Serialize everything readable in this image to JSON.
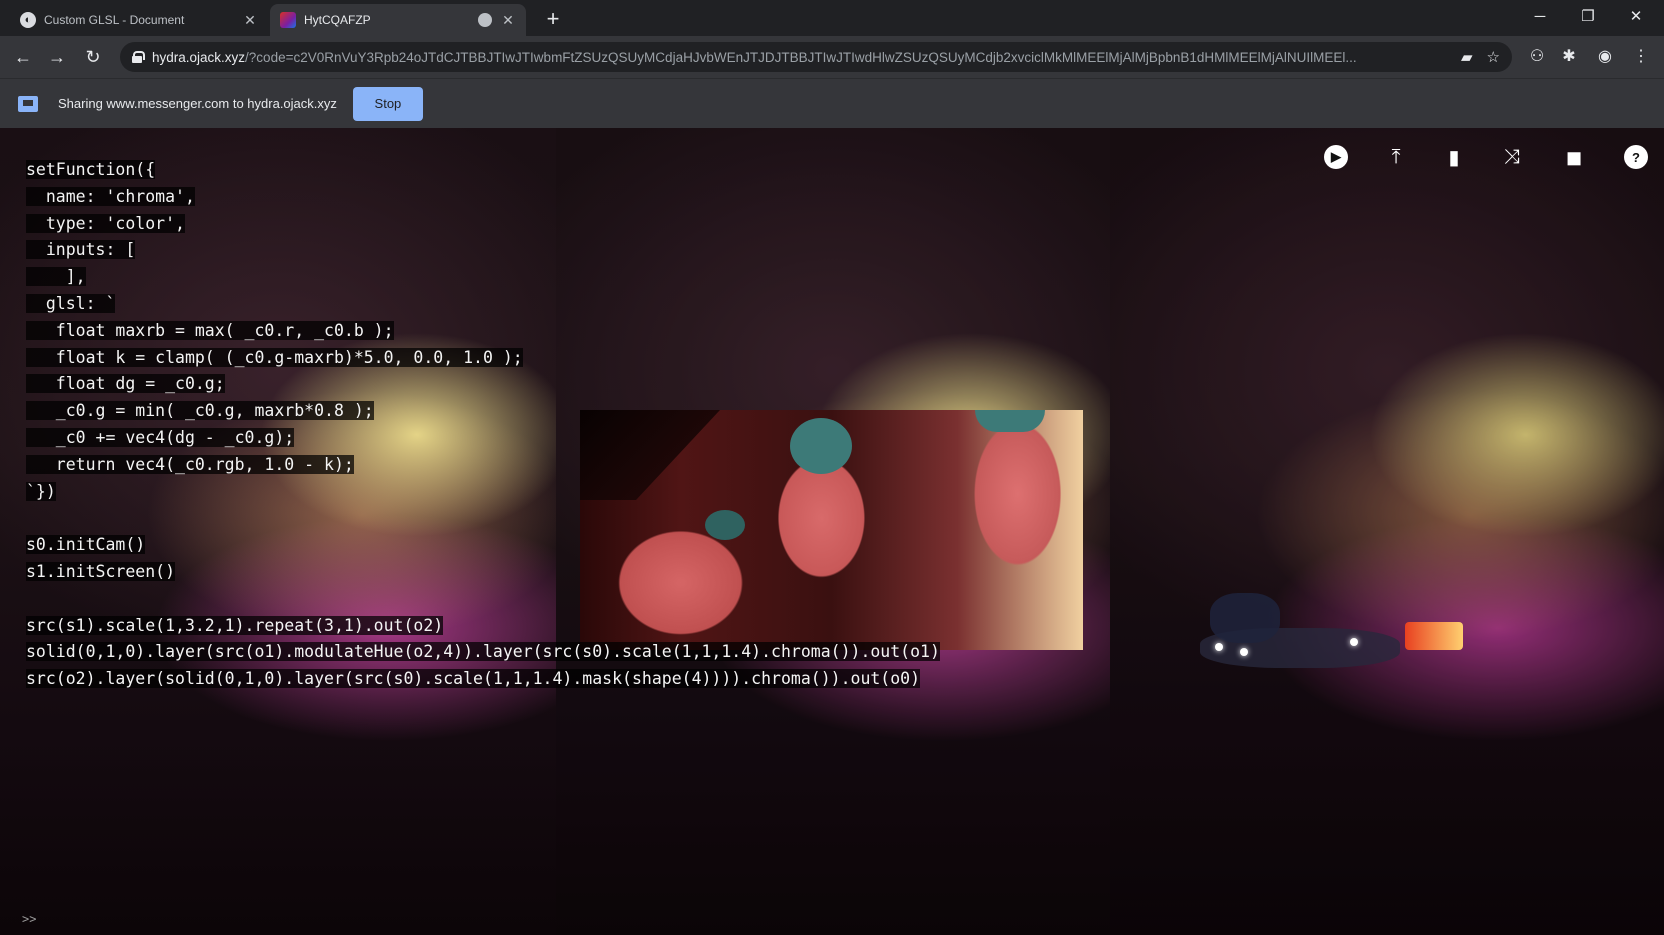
{
  "browser": {
    "tabs": [
      {
        "title": "Custom GLSL - Document",
        "active": false
      },
      {
        "title": "HytCQAFZP",
        "active": true
      }
    ],
    "new_tab_label": "+",
    "window_controls": {
      "minimize": "─",
      "restore": "❐",
      "close": "✕"
    },
    "url_host": "hydra.ojack.xyz",
    "url_rest": "/?code=c2V0RnVuY3Rpb24oJTdCJTBBJTIwJTIwbmFtZSUzQSUyMCdjaHJvbWEnJTJDJTBBJTIwJTIwdHlwZSUzQSUyMCdjb2xvciclMkMlMEElMjAlMjBpbnB1dHMlMEElMjAlNUIlMEEl...",
    "omnibox_icons": [
      "cast-icon",
      "star-icon"
    ],
    "toolbar_icons": [
      "extension-badge-icon",
      "puzzle-icon",
      "profile-icon",
      "menu-icon"
    ]
  },
  "share_bar": {
    "text": "Sharing www.messenger.com to hydra.ojack.xyz",
    "stop_label": "Stop"
  },
  "editor": {
    "lines": [
      "setFunction({",
      "  name: 'chroma',",
      "  type: 'color',",
      "  inputs: [",
      "    ],",
      "  glsl: `",
      "   float maxrb = max( _c0.r, _c0.b );",
      "   float k = clamp( (_c0.g-maxrb)*5.0, 0.0, 1.0 );",
      "   float dg = _c0.g;",
      "   _c0.g = min( _c0.g, maxrb*0.8 );",
      "   _c0 += vec4(dg - _c0.g);",
      "   return vec4(_c0.rgb, 1.0 - k);",
      "`})",
      "",
      "s0.initCam()",
      "s1.initScreen()",
      "",
      "src(s1).scale(1,3.2,1).repeat(3,1).out(o2)",
      "solid(0,1,0).layer(src(o1).modulateHue(o2,4)).layer(src(s0).scale(1,1,1.4).chroma()).out(o1)",
      "src(o2).layer(solid(0,1,0).layer(src(s0).scale(1,1,1.4).mask(shape(4)))).chroma()).out(o0)"
    ],
    "prompt": ">>"
  },
  "hydra_toolbar": [
    {
      "name": "run-icon",
      "glyph": "▶"
    },
    {
      "name": "upload-icon",
      "glyph": "⤒"
    },
    {
      "name": "trash-icon",
      "glyph": "🗑"
    },
    {
      "name": "shuffle-icon",
      "glyph": "⤨"
    },
    {
      "name": "gallery-icon",
      "glyph": "◼"
    },
    {
      "name": "help-icon",
      "glyph": "?"
    }
  ]
}
